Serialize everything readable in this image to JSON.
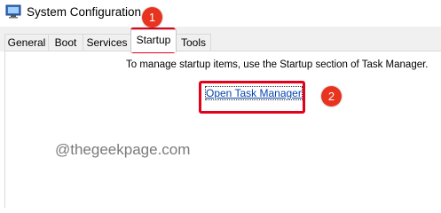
{
  "window": {
    "title": "System Configuration",
    "icon": "system-configuration-icon"
  },
  "tabs": [
    {
      "label": "General",
      "active": false
    },
    {
      "label": "Boot",
      "active": false
    },
    {
      "label": "Services",
      "active": false
    },
    {
      "label": "Startup",
      "active": true
    },
    {
      "label": "Tools",
      "active": false
    }
  ],
  "startup": {
    "info": "To manage startup items, use the Startup section of Task Manager.",
    "link_label": "Open Task Manager"
  },
  "annotations": {
    "step1": "1",
    "step2": "2",
    "highlight_color": "#e3001b",
    "marker_color": "#e8331f"
  },
  "watermark": "@thegeekpage.com"
}
